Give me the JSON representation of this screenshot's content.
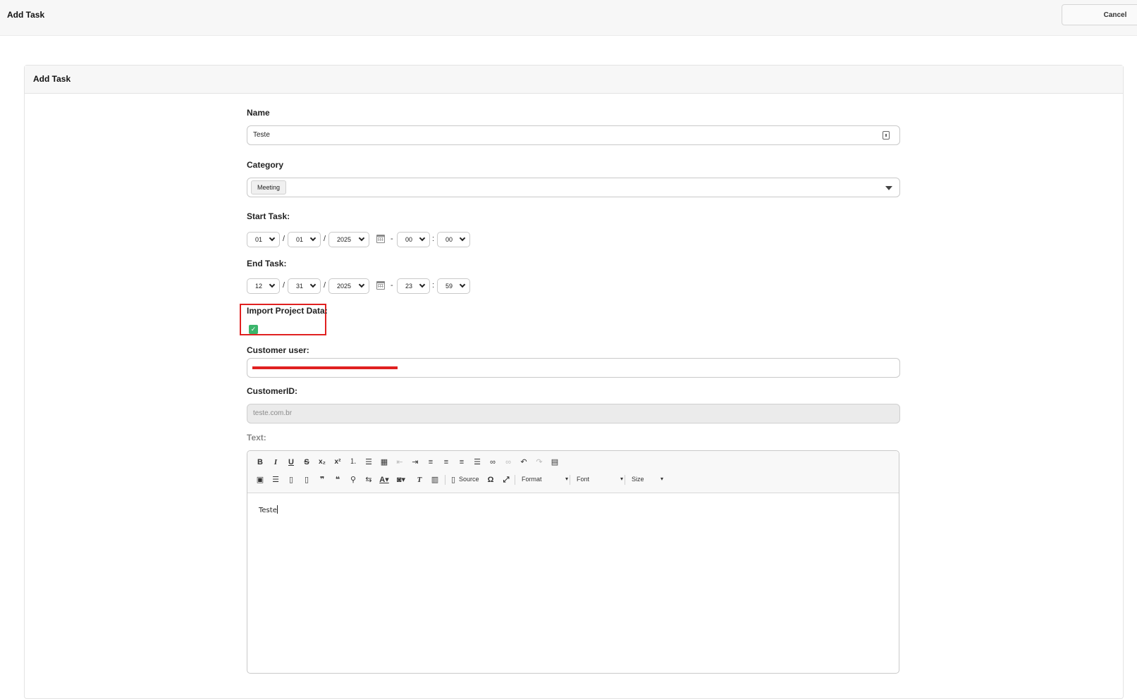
{
  "header": {
    "title": "Add Task",
    "cancel_label": "Cancel"
  },
  "panel": {
    "title": "Add Task"
  },
  "form": {
    "name": {
      "label": "Name",
      "value": "Teste"
    },
    "category": {
      "label": "Category",
      "selected": "Meeting"
    },
    "start": {
      "label": "Start Task:",
      "month": "01",
      "day": "01",
      "year": "2025",
      "hour": "00",
      "minute": "00"
    },
    "end": {
      "label": "End Task:",
      "month": "12",
      "day": "31",
      "year": "2025",
      "hour": "23",
      "minute": "59"
    },
    "import_project": {
      "label": "Import Project Data:",
      "checked": true
    },
    "customer_user": {
      "label": "Customer user:"
    },
    "customer_id": {
      "label": "CustomerID:",
      "value": "teste.com.br"
    },
    "text": {
      "label": "Text:",
      "content": "Teste"
    }
  },
  "separators": {
    "date": "/",
    "time_range": "-",
    "time": ":"
  },
  "editor_toolbar": {
    "row1": [
      "bold-icon",
      "italic-icon",
      "underline-icon",
      "strikethrough-icon",
      "subscript-icon",
      "superscript-icon",
      "numbered-list-icon",
      "bulleted-list-icon",
      "table-icon",
      "outdent-icon",
      "indent-icon",
      "align-left-icon",
      "align-center-icon",
      "align-right-icon",
      "justify-icon",
      "link-icon",
      "unlink-icon",
      "undo-icon",
      "redo-icon",
      "page-break-icon"
    ],
    "row2": [
      "image-icon",
      "horizontal-line-icon",
      "paste-icon",
      "paste-text-icon",
      "blockquote-icon",
      "blockquote-alt-icon",
      "find-icon",
      "replace-icon",
      "text-color-icon",
      "background-color-icon",
      "remove-format-icon",
      "templates-icon",
      "source-icon",
      "special-char-icon",
      "maximize-icon"
    ],
    "source_label": "Source",
    "format_label": "Format",
    "font_label": "Font",
    "size_label": "Size"
  },
  "colors": {
    "highlight": "#e02020",
    "checkbox": "#3bb56b"
  }
}
